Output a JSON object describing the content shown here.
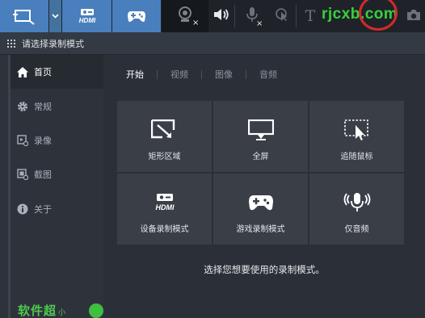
{
  "toolbar": {
    "watermark_text": "rjcxb.com",
    "tools": [
      {
        "name": "region-capture",
        "icon": "screen-region-plus-icon"
      },
      {
        "name": "dropdown",
        "icon": "chevron-down-icon"
      },
      {
        "name": "hdmi",
        "icon": "hdmi-device-icon"
      },
      {
        "name": "game",
        "icon": "gamepad-icon"
      },
      {
        "name": "webcam",
        "icon": "webcam-icon",
        "disabled_mark": "×"
      },
      {
        "name": "speaker",
        "icon": "speaker-icon"
      },
      {
        "name": "microphone",
        "icon": "microphone-icon",
        "disabled_mark": "×"
      },
      {
        "name": "cursor",
        "icon": "cursor-click-icon"
      },
      {
        "name": "text",
        "icon": "text-t-icon",
        "glyph": "T"
      },
      {
        "name": "camera",
        "icon": "camera-icon"
      }
    ]
  },
  "window": {
    "title": "请选择录制模式"
  },
  "sidebar": {
    "items": [
      {
        "label": "首页",
        "icon": "home-icon",
        "active": true
      },
      {
        "label": "常规",
        "icon": "gear-icon",
        "active": false
      },
      {
        "label": "录像",
        "icon": "video-record-icon",
        "active": false
      },
      {
        "label": "截图",
        "icon": "screenshot-icon",
        "active": false
      },
      {
        "label": "关于",
        "icon": "info-icon",
        "active": false
      }
    ]
  },
  "main": {
    "tabs": [
      {
        "label": "开始",
        "active": true
      },
      {
        "label": "视频",
        "active": false
      },
      {
        "label": "图像",
        "active": false
      },
      {
        "label": "音频",
        "active": false
      }
    ],
    "modes": [
      {
        "label": "矩形区域",
        "icon": "rectangle-region-icon"
      },
      {
        "label": "全屏",
        "icon": "monitor-icon"
      },
      {
        "label": "追随鼠标",
        "icon": "follow-mouse-icon"
      },
      {
        "label": "设备录制模式",
        "icon": "hdmi-device-icon"
      },
      {
        "label": "游戏录制模式",
        "icon": "gamepad-icon"
      },
      {
        "label": "仅音频",
        "icon": "microphone-wave-icon"
      }
    ],
    "hint": "选择您想要使用的录制模式。"
  },
  "brand": {
    "text": "软件超",
    "small": "小"
  },
  "colors": {
    "accent_blue": "#4a7fbd",
    "toolbar_bg": "#1f2329",
    "panel_bg": "#2b3038",
    "tile_bg": "#3a3f47",
    "watermark_green": "#39d03c",
    "annotation_red": "#d42a2a"
  }
}
